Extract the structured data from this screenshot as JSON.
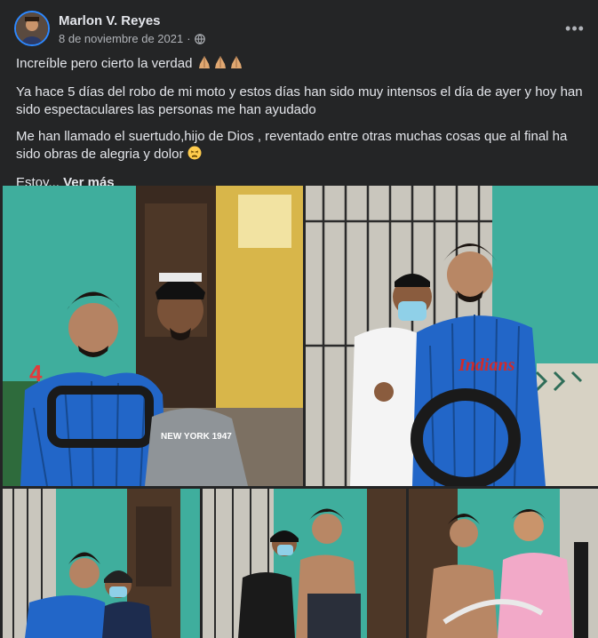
{
  "post": {
    "author": "Marlon V. Reyes",
    "date": "8 de noviembre de 2021",
    "separator": "·",
    "privacy_icon": "globe-icon",
    "more_label": "•••",
    "paragraphs": [
      "Increíble pero cierto la verdad",
      "Ya hace 5 días del robo de mi moto y estos días han sido muy intensos el día de ayer y hoy han sido espectaculares las personas me han ayudado",
      "Me han llamado el suertudo,hijo de Dios , reventado entre otras muchas cosas que al final ha sido obras de alegria y dolor"
    ],
    "truncated_text": "Estoy...",
    "see_more": "Ver más",
    "emojis": {
      "prayer": "pray-hands-emoji",
      "tired": "tired-face-emoji"
    }
  },
  "photos": {
    "count": 5,
    "captions": {
      "jersey_left": "4",
      "jersey_right": "Indians",
      "hoodie": "NEW YORK 1947"
    }
  },
  "colors": {
    "background": "#242526",
    "text": "#e4e6eb",
    "secondary_text": "#b0b3b8",
    "accent": "#2d88ff",
    "jersey_blue": "#2266c8",
    "wall_teal": "#3fae9d"
  }
}
